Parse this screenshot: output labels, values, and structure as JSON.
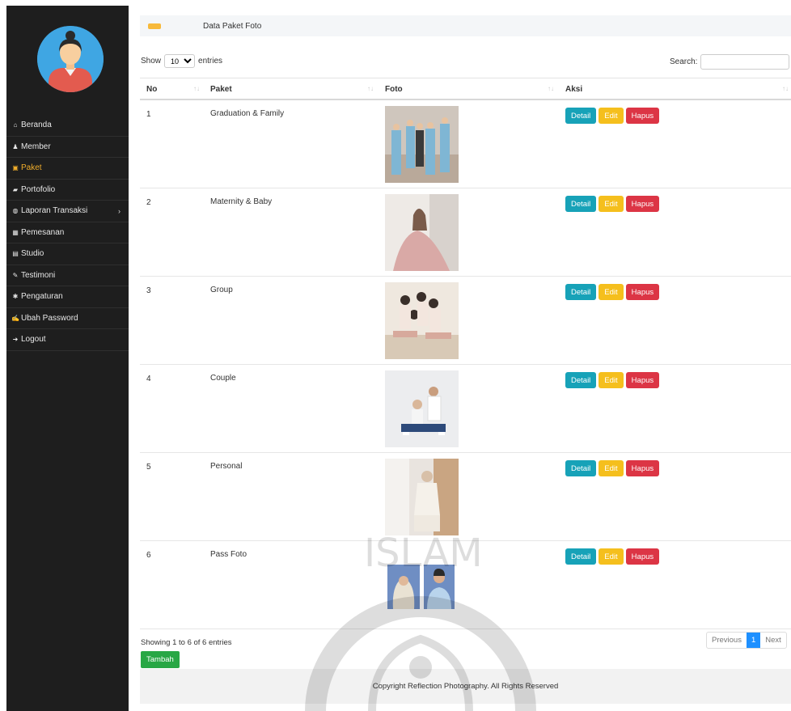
{
  "sidebar": {
    "items": [
      {
        "label": "Beranda",
        "icon": "home-icon",
        "glyph": "⌂"
      },
      {
        "label": "Member",
        "icon": "user-icon",
        "glyph": "♟"
      },
      {
        "label": "Paket",
        "icon": "image-icon",
        "glyph": "▣"
      },
      {
        "label": "Portofolio",
        "icon": "book-icon",
        "glyph": "▰"
      },
      {
        "label": "Laporan Transaksi",
        "icon": "globe-icon",
        "glyph": "◍"
      },
      {
        "label": "Pemesanan",
        "icon": "calendar-icon",
        "glyph": "▦"
      },
      {
        "label": "Studio",
        "icon": "studio-icon",
        "glyph": "▤"
      },
      {
        "label": "Testimoni",
        "icon": "pencil-icon",
        "glyph": "✎"
      },
      {
        "label": "Pengaturan",
        "icon": "gear-icon",
        "glyph": "✱"
      },
      {
        "label": "Ubah Password",
        "icon": "edit-icon",
        "glyph": "✍"
      },
      {
        "label": "Logout",
        "icon": "logout-icon",
        "glyph": "➜"
      }
    ],
    "chevron": "›"
  },
  "breadcrumb": {
    "title": "Data Paket Foto"
  },
  "table_controls": {
    "show_label": "Show",
    "show_value": "10",
    "entries_label": "entries",
    "search_label": "Search:"
  },
  "table": {
    "headers": {
      "no": "No",
      "paket": "Paket",
      "foto": "Foto",
      "aksi": "Aksi"
    },
    "sort_glyph": "↑↓",
    "rows": [
      {
        "no": "1",
        "paket": "Graduation & Family"
      },
      {
        "no": "2",
        "paket": "Maternity & Baby"
      },
      {
        "no": "3",
        "paket": "Group"
      },
      {
        "no": "4",
        "paket": "Couple"
      },
      {
        "no": "5",
        "paket": "Personal"
      },
      {
        "no": "6",
        "paket": "Pass Foto"
      }
    ],
    "actions": {
      "detail": "Detail",
      "edit": "Edit",
      "hapus": "Hapus"
    }
  },
  "info": "Showing 1 to 6 of 6 entries",
  "tambah": "Tambah",
  "pager": {
    "previous": "Previous",
    "current": "1",
    "next": "Next"
  },
  "footer": "Copyright Reflection Photography. All Rights Reserved",
  "watermark_text": "ISLAM INDONESIA UNIVERSITAS",
  "colors": {
    "sidebar": "#1e1e1e",
    "active": "#f0ad2b",
    "detail": "#17a2b8",
    "edit": "#f5bf1d",
    "hapus": "#dc3545",
    "tambah": "#28a745",
    "page_active": "#1e90ff"
  }
}
